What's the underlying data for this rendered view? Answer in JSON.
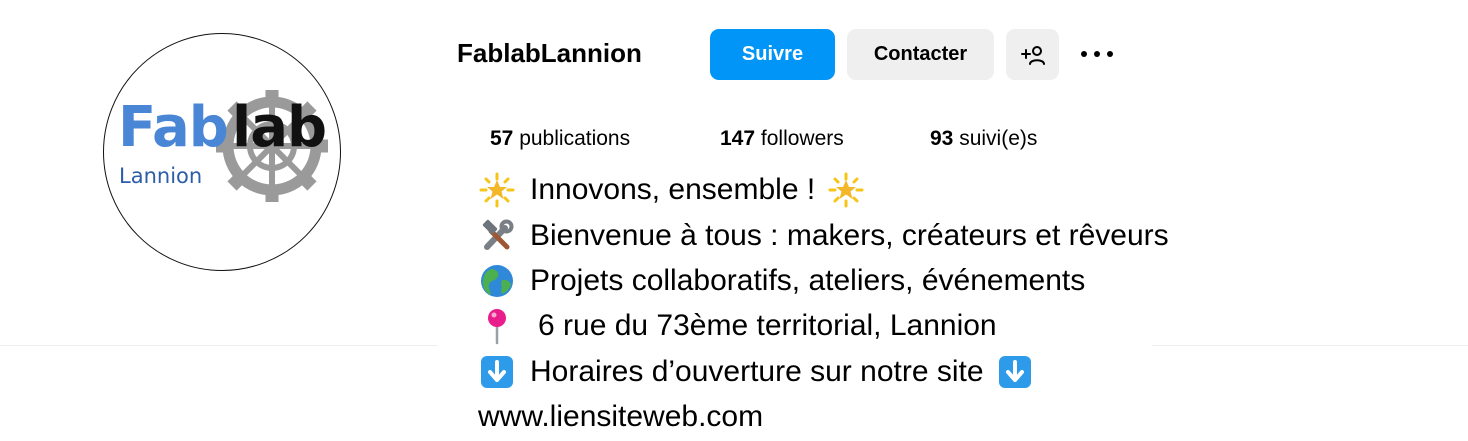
{
  "profile": {
    "username": "FablabLannion",
    "avatar": {
      "logo_word_blue": "Fab",
      "logo_word_black": "lab",
      "logo_subtitle": "Lannion"
    }
  },
  "actions": {
    "follow_label": "Suivre",
    "contact_label": "Contacter",
    "add_user_icon": "add-user-icon",
    "more_icon": "more-options-icon"
  },
  "stats": {
    "posts_count": "57",
    "posts_label": "publications",
    "followers_count": "147",
    "followers_label": "followers",
    "following_count": "93",
    "following_label": "suivi(e)s"
  },
  "bio": {
    "line1": "Innovons, ensemble !",
    "line2": "Bienvenue à tous : makers, créateurs et rêveurs",
    "line3": "Projets collaboratifs, ateliers, événements",
    "line4": "6 rue du 73ème territorial, Lannion",
    "line5": "Horaires d’ouverture sur notre site",
    "link": "www.liensiteweb.com"
  },
  "colors": {
    "follow_button": "#0095f6",
    "secondary_button": "#efefef",
    "logo_blue": "#4a86d6",
    "logo_subtitle_blue": "#2c5da8"
  }
}
